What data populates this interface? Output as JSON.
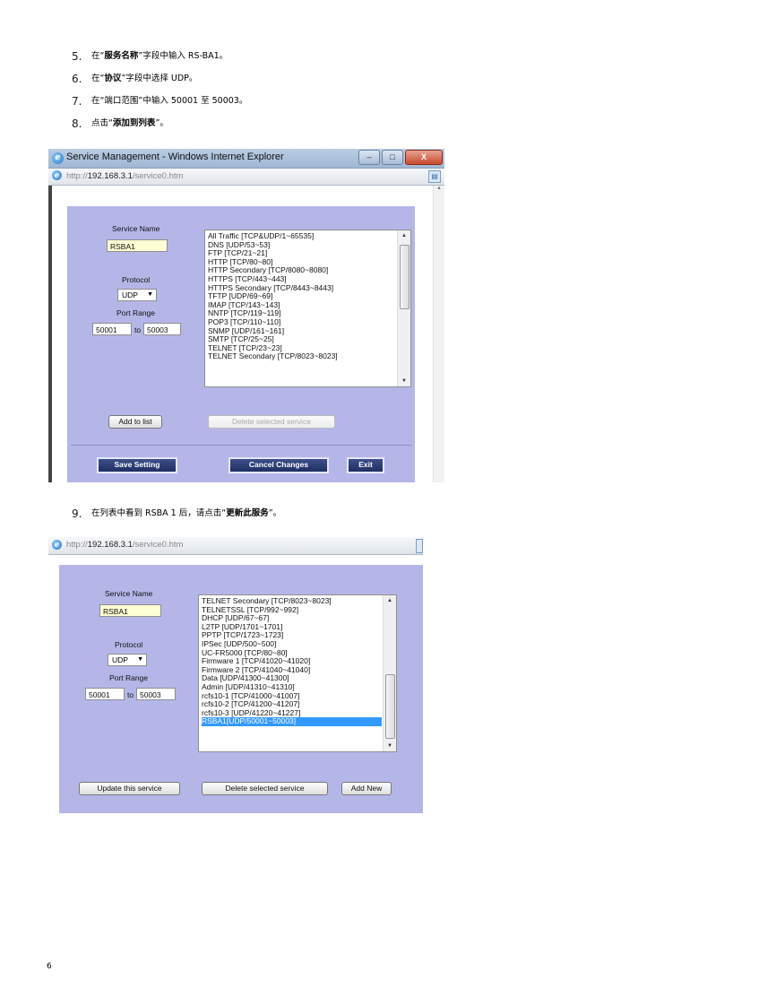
{
  "steps": [
    {
      "num": "5.",
      "pre": "在“",
      "bold": "服务名称",
      "post": "”字段中输入 RS-BA1。"
    },
    {
      "num": "6.",
      "pre": "在“",
      "bold": "协议",
      "post": "”字段中选择 UDP。"
    },
    {
      "num": "7.",
      "text": "在“端口范围”中输入 50001 至 50003。"
    },
    {
      "num": "8.",
      "pre": "点击“",
      "bold": "添加到列表",
      "post": "”。"
    },
    {
      "num": "9.",
      "pre": "在列表中看到 RSBA 1 后，请点击“",
      "bold": "更新此服务",
      "post": "”。"
    }
  ],
  "screenshot1": {
    "window_title": "Service Management - Windows Internet Explorer",
    "address_prefix": "http://",
    "address_host": "192.168.3.1",
    "address_path": "/service0.htm",
    "service_name_label": "Service Name",
    "service_name_value": "RSBA1",
    "protocol_label": "Protocol",
    "protocol_value": "UDP",
    "port_range_label": "Port Range",
    "port_from": "50001",
    "port_to_label": "to",
    "port_to": "50003",
    "services": [
      "All Traffic [TCP&UDP/1~65535]",
      "DNS [UDP/53~53]",
      "FTP [TCP/21~21]",
      "HTTP [TCP/80~80]",
      "HTTP Secondary [TCP/8080~8080]",
      "HTTPS [TCP/443~443]",
      "HTTPS Secondary [TCP/8443~8443]",
      "TFTP [UDP/69~69]",
      "IMAP [TCP/143~143]",
      "NNTP [TCP/119~119]",
      "POP3 [TCP/110~110]",
      "SNMP [UDP/161~161]",
      "SMTP [TCP/25~25]",
      "TELNET [TCP/23~23]",
      "TELNET Secondary [TCP/8023~8023]"
    ],
    "add_to_list": "Add to list",
    "delete_selected": "Delete selected service",
    "save_setting": "Save Setting",
    "cancel_changes": "Cancel Changes",
    "exit": "Exit"
  },
  "screenshot2": {
    "address_prefix": "http://",
    "address_host": "192.168.3.1",
    "address_path": "/service0.htm",
    "service_name_label": "Service Name",
    "service_name_value": "RSBA1",
    "protocol_label": "Protocol",
    "protocol_value": "UDP",
    "port_range_label": "Port Range",
    "port_from": "50001",
    "port_to_label": "to",
    "port_to": "50003",
    "services": [
      "TELNET Secondary [TCP/8023~8023]",
      "TELNETSSL [TCP/992~992]",
      "DHCP [UDP/67~67]",
      "L2TP [UDP/1701~1701]",
      "PPTP [TCP/1723~1723]",
      "IPSec [UDP/500~500]",
      "UC-FR5000 [TCP/80~80]",
      "Firmware 1 [TCP/41020~41020]",
      "Firmware 2 [TCP/41040~41040]",
      "Data [UDP/41300~41300]",
      "Admin [UDP/41310~41310]",
      "rcfs10-1 [TCP/41000~41007]",
      "rcfs10-2 [TCP/41200~41207]",
      "rcfs10-3 [UDP/41220~41227]",
      "RSBA1[UDP/50001~50003]"
    ],
    "selected_service": "RSBA1[UDP/50001~50003]",
    "update_service": "Update this service",
    "delete_selected": "Delete selected service",
    "add_new": "Add New"
  },
  "page_number": "6"
}
